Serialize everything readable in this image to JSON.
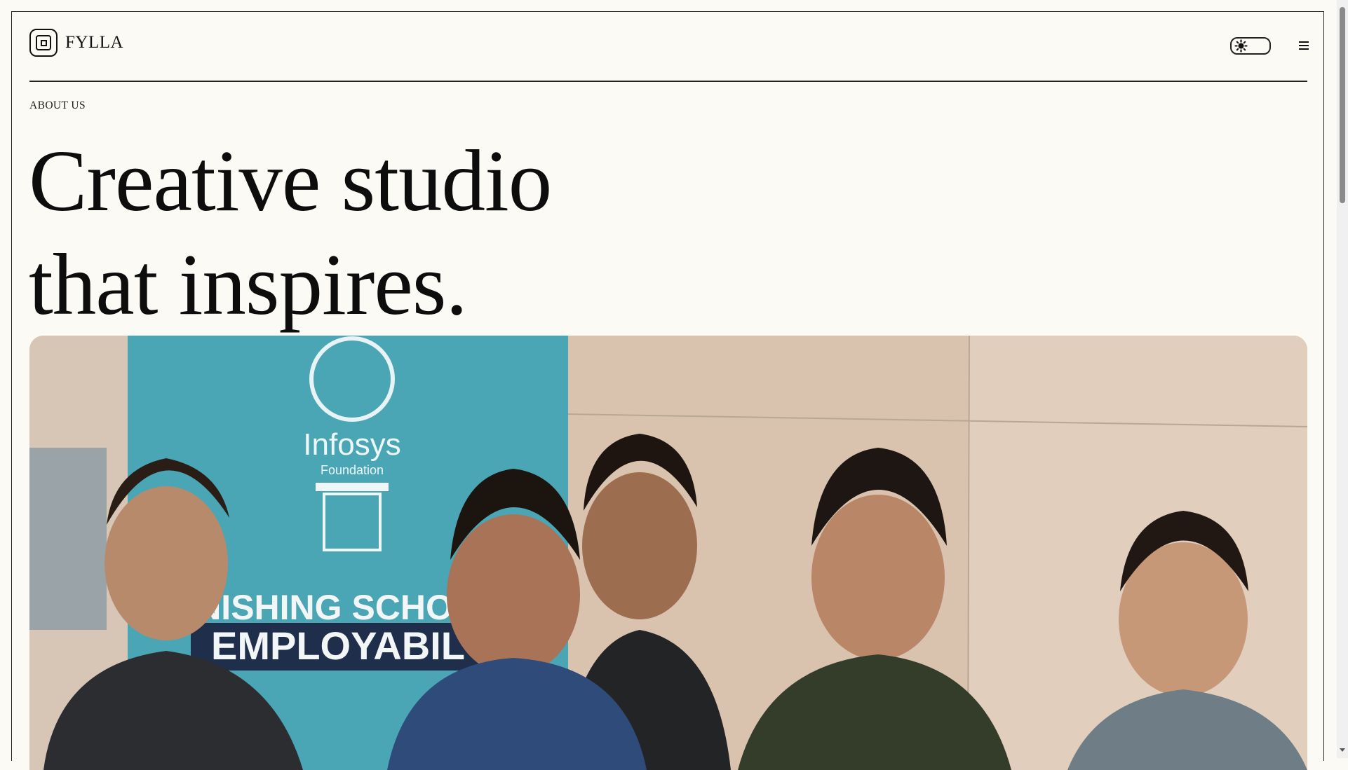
{
  "brand": {
    "name": "FYLLA",
    "logo_icon": "square-logo-icon"
  },
  "header": {
    "theme_toggle_icon": "sun-icon",
    "menu_icon": "hamburger-menu-icon"
  },
  "hero": {
    "eyebrow": "ABOUT US",
    "title_line_1": "Creative studio",
    "title_line_2": "that inspires."
  },
  "photo": {
    "banner_brand": "Infosys",
    "banner_sub": "Foundation",
    "banner_line_1": "NISHING SCHOO",
    "banner_line_2": "EMPLOYABIL"
  },
  "colors": {
    "background": "#fbfaf5",
    "text": "#111111",
    "border": "#222222",
    "banner_teal": "#49a7b6"
  }
}
